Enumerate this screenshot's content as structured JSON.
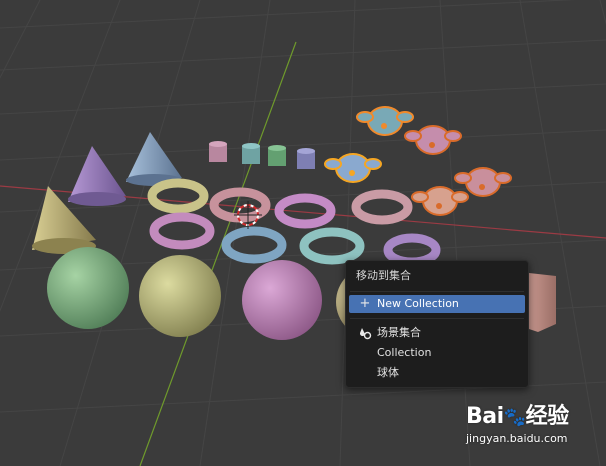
{
  "context_menu": {
    "title": "移动到集合",
    "new_collection": {
      "label": "New Collection",
      "icon": "plus-icon"
    },
    "scene_collection": {
      "label": "场景集合",
      "icon": "scene-collection-icon"
    },
    "items": [
      {
        "label": "Collection"
      },
      {
        "label": "球体"
      }
    ]
  },
  "watermark": {
    "logo_text": "Bai",
    "logo_suffix": "经验",
    "url": "jingyan.baidu.com"
  },
  "colors": {
    "viewport_bg": "#3b3b3b",
    "grid": "#454545",
    "x_axis": "#9b3b44",
    "y_axis": "#6f9a2c",
    "menu_bg": "#1d1d1d",
    "menu_highlight": "#4772b3",
    "selection_outline": "#f08a2c"
  }
}
